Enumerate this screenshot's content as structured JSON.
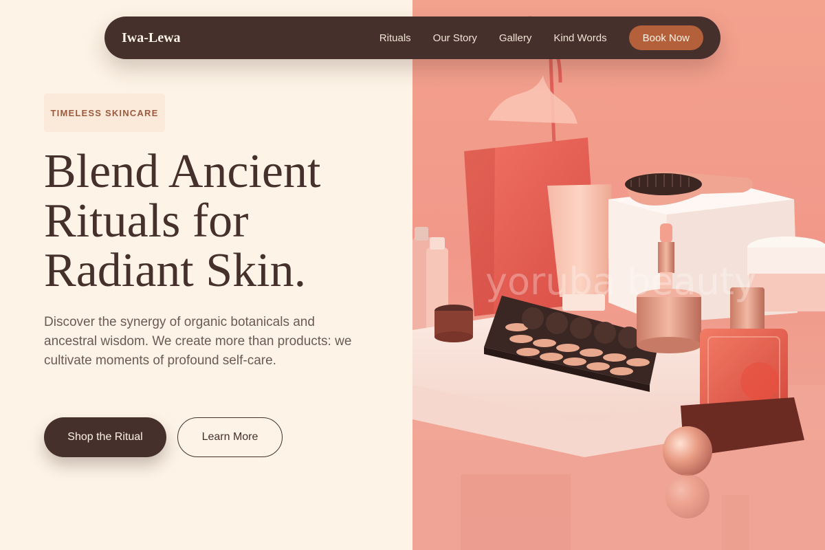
{
  "nav": {
    "brand": "Iwa-Lewa",
    "links": [
      "Rituals",
      "Our Story",
      "Gallery",
      "Kind Words"
    ],
    "cta": "Book Now"
  },
  "hero": {
    "badge": "TIMELESS SKINCARE",
    "headline_lines": [
      "Blend Ancient",
      "Rituals for",
      "Radiant Skin."
    ],
    "description": "Discover the synergy of organic botanicals and ancestral wisdom. We create more than products: we cultivate moments of profound self-care.",
    "primary_cta": "Shop the Ritual",
    "secondary_cta": "Learn More"
  },
  "image": {
    "watermark": "yoruba beauty",
    "alt": "cosmetics arrangement"
  },
  "colors": {
    "background": "#fdf3e6",
    "dark_brown": "#45302b",
    "accent": "#b4603a",
    "image_bg": "#f3a28e"
  }
}
